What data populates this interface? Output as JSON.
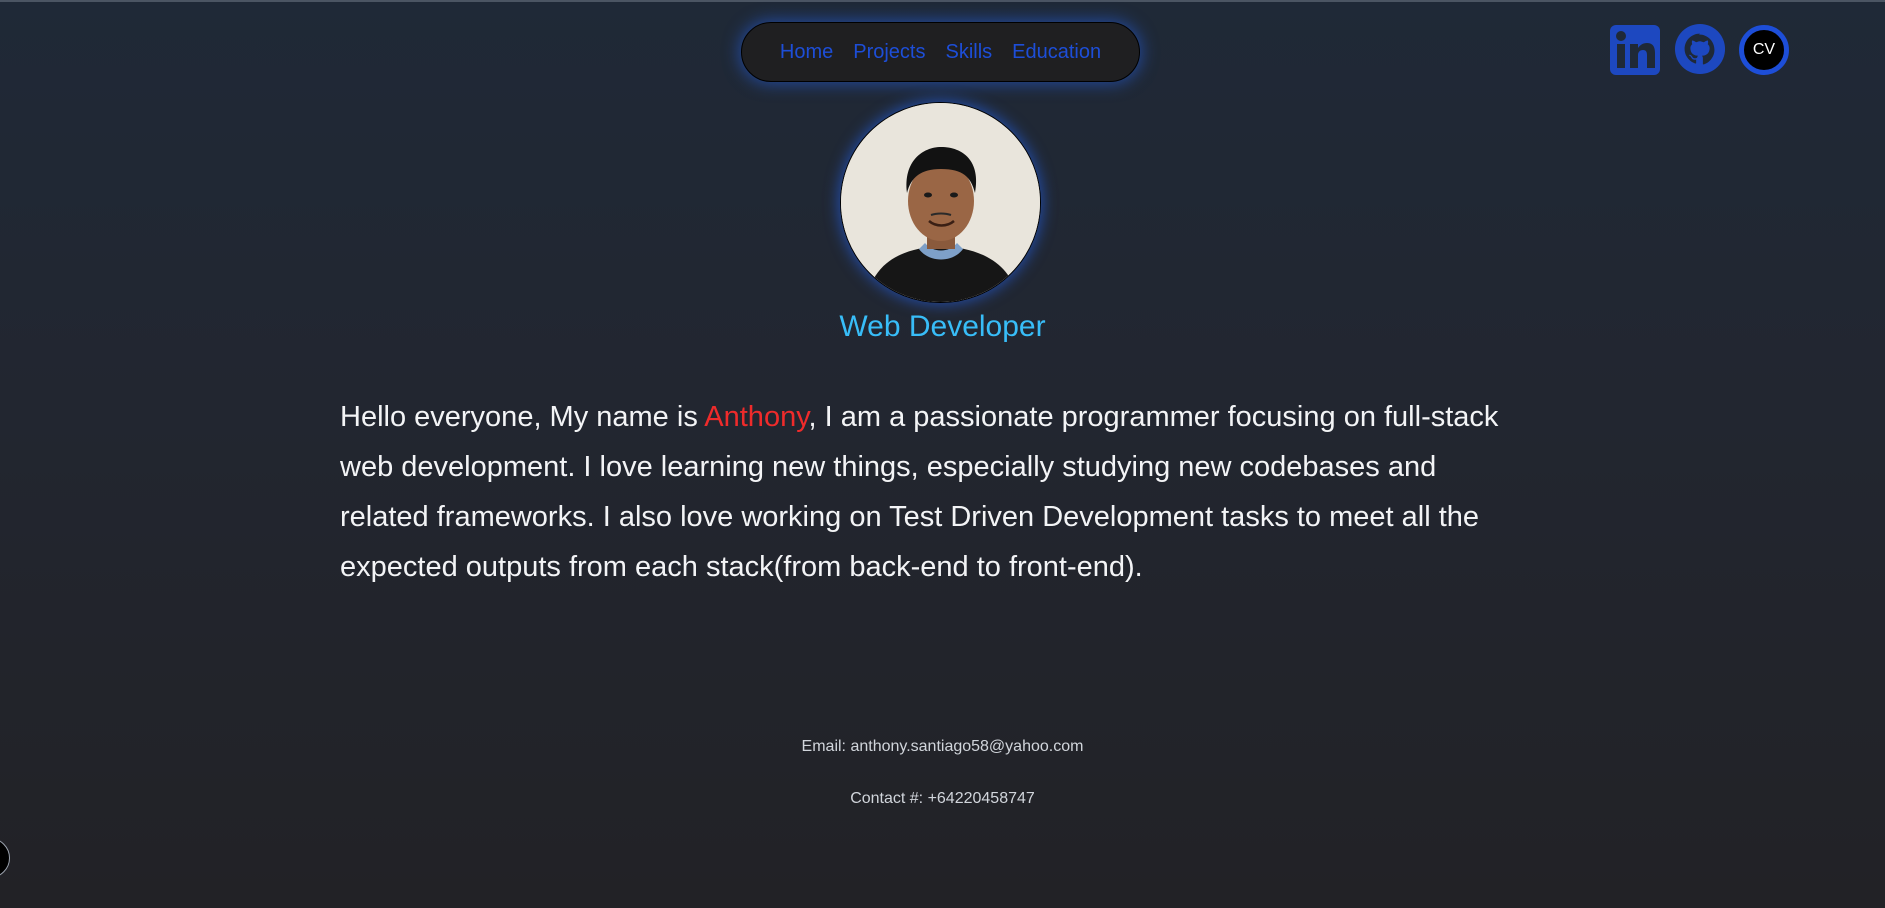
{
  "nav": {
    "items": [
      "Home",
      "Projects",
      "Skills",
      "Education"
    ]
  },
  "social": {
    "linkedin_icon": "linkedin-icon",
    "github_icon": "github-icon",
    "cv_label": "CV"
  },
  "hero": {
    "role": "Web Developer",
    "bio_before": "Hello everyone, My name is ",
    "bio_name": "Anthony",
    "bio_after": ", I am a passionate programmer focusing on full-stack web development. I love learning new things, especially studying new codebases and related frameworks. I also love working on Test Driven Development tasks to meet all the expected outputs from each stack(from back-end to front-end)."
  },
  "footer": {
    "email": "Email: anthony.santiago58@yahoo.com",
    "contact": "Contact #: +64220458747"
  },
  "colors": {
    "accent": "#1d4ed8",
    "role": "#38bdf8",
    "name_highlight": "#ef2b2b"
  }
}
